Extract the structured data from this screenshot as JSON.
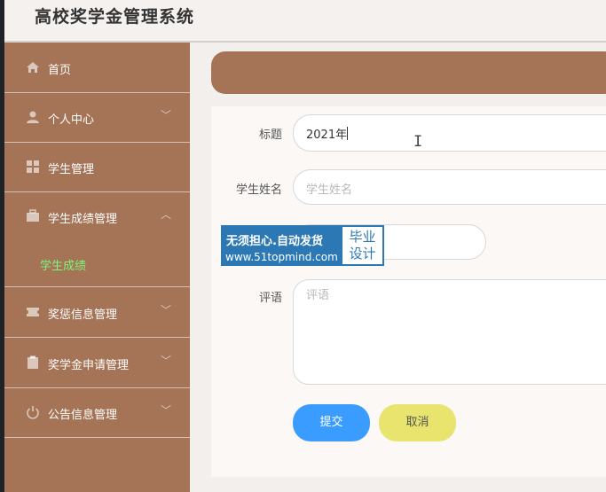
{
  "app": {
    "title": "高校奖学金管理系统"
  },
  "sidebar": {
    "items": [
      {
        "label": "首页",
        "icon": "home-icon"
      },
      {
        "label": "个人中心",
        "icon": "user-icon",
        "chevron": "﹀"
      },
      {
        "label": "学生管理",
        "icon": "grid-icon",
        "chevron": "﹀"
      },
      {
        "label": "学生成绩管理",
        "icon": "briefcase-icon",
        "chevron": "︿"
      },
      {
        "label": "奖惩信息管理",
        "icon": "ticket-icon",
        "chevron": "﹀"
      },
      {
        "label": "奖学金申请管理",
        "icon": "clipboard-icon",
        "chevron": "﹀"
      },
      {
        "label": "公告信息管理",
        "icon": "power-icon",
        "chevron": "﹀"
      }
    ],
    "submenu": {
      "label": "学生成绩"
    }
  },
  "form": {
    "title_label": "标题",
    "title_value": "2021年",
    "student_label": "学生姓名",
    "student_placeholder": "学生姓名",
    "comment_label": "评语",
    "comment_placeholder": "评语",
    "submit": "提交",
    "cancel": "取消"
  },
  "watermark": {
    "line1": "无须担心.自动发货",
    "line2": "www.51topmind.com",
    "right1": "毕业",
    "right2": "设计"
  },
  "colors": {
    "sidebar": "#a57456",
    "active_submenu": "#7ef57a",
    "submit": "#3b9cff",
    "cancel": "#e8e46e"
  }
}
